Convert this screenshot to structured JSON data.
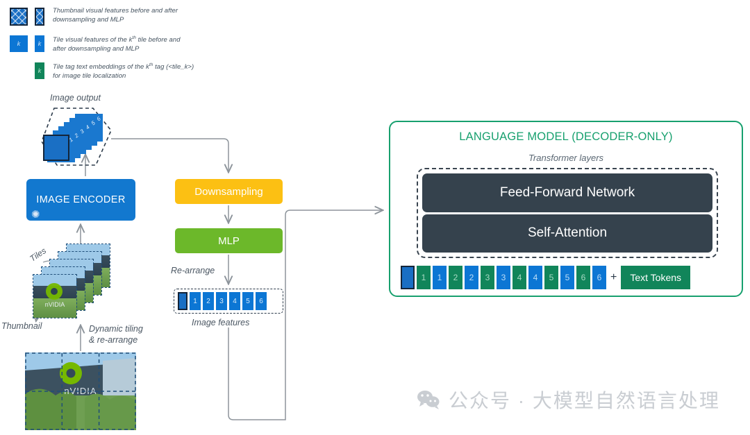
{
  "legend": {
    "items": [
      {
        "id": "thumbnail-features",
        "swatch": "thumbnail-hatched-pair",
        "text_line1": "Thumbnail visual features before and after",
        "text_line2": "downsampling and MLP"
      },
      {
        "id": "tile-features",
        "swatch": "tile-blue-pair",
        "swatch_label": "k",
        "text_line1": "Tile visual features of the k",
        "text_sup": "th",
        "text_line1b": " tile before and",
        "text_line2": "after downsampling and MLP"
      },
      {
        "id": "tile-tag-embeddings",
        "swatch": "tag-green",
        "swatch_label": "k",
        "text_line1": "Tile tag text embeddings of the k",
        "text_sup": "th",
        "text_line1b": " tag (<tile_k>)",
        "text_line2": "for image tile localization"
      }
    ]
  },
  "left_column": {
    "image_output_label": "Image output",
    "stack_numbers": [
      "1",
      "2",
      "3",
      "4",
      "5",
      "6"
    ],
    "encoder_label": "IMAGE ENCODER",
    "encoder_frozen_icon": "snowflake-icon",
    "tiles_label": "Tiles",
    "thumbnail_label": "Thumbnail",
    "dynamic_tiling_line1": "Dynamic tiling",
    "dynamic_tiling_line2": "& re-arrange",
    "source_image_alt": "nvidia-building-photo",
    "tile_grid": {
      "cols": 3,
      "rows": 2
    }
  },
  "middle_column": {
    "downsampling_label": "Downsampling",
    "mlp_label": "MLP",
    "rearrange_label": "Re-arrange",
    "image_features_label": "Image features",
    "feature_tokens": [
      "1",
      "2",
      "3",
      "4",
      "5",
      "6"
    ]
  },
  "language_model": {
    "title": "LANGUAGE MODEL (DECODER-ONLY)",
    "transformer_label": "Transformer layers",
    "layers": [
      "Feed-Forward Network",
      "Self-Attention"
    ],
    "tokens": [
      {
        "type": "thumbnail",
        "label": ""
      },
      {
        "type": "green",
        "label": "1"
      },
      {
        "type": "blue",
        "label": "1"
      },
      {
        "type": "green",
        "label": "2"
      },
      {
        "type": "blue",
        "label": "2"
      },
      {
        "type": "green",
        "label": "3"
      },
      {
        "type": "blue",
        "label": "3"
      },
      {
        "type": "green",
        "label": "4"
      },
      {
        "type": "blue",
        "label": "4"
      },
      {
        "type": "green",
        "label": "5"
      },
      {
        "type": "blue",
        "label": "5"
      },
      {
        "type": "green",
        "label": "6"
      },
      {
        "type": "blue",
        "label": "6"
      }
    ],
    "plus_symbol": "+",
    "text_tokens_label": "Text Tokens"
  },
  "watermark": {
    "icon": "wechat-icon",
    "text": "公众号 · 大模型自然语言处理"
  },
  "colors": {
    "encoder_blue": "#1278cf",
    "downsampling_yellow": "#fcc013",
    "mlp_green": "#6cb82a",
    "llm_border_green": "#17a06e",
    "transformer_dark": "#35424d",
    "tile_blue": "#0c76d4",
    "tag_green": "#11855a",
    "line_gray": "#8d949b"
  }
}
